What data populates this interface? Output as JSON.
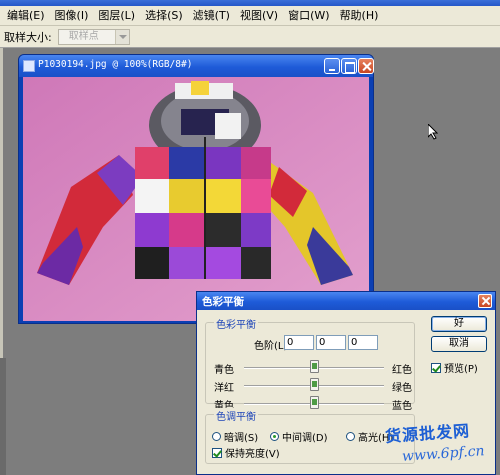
{
  "menu": [
    "编辑(E)",
    "图像(I)",
    "图层(L)",
    "选择(S)",
    "滤镜(T)",
    "视图(V)",
    "窗口(W)",
    "帮助(H)"
  ],
  "options": {
    "label": "取样大小:",
    "select_value": "取样点"
  },
  "document": {
    "title": "P1030194.jpg @ 100%(RGB/8#)"
  },
  "dialog": {
    "title": "色彩平衡",
    "group1": "色彩平衡",
    "levels_label": "色阶(L):",
    "levels": [
      "0",
      "0",
      "0"
    ],
    "rows": [
      {
        "left": "青色",
        "right": "红色",
        "value": 0
      },
      {
        "left": "洋红",
        "right": "绿色",
        "value": 0
      },
      {
        "left": "黄色",
        "right": "蓝色",
        "value": 0
      }
    ],
    "group2": "色调平衡",
    "radios": [
      "暗调(S)",
      "中间调(D)",
      "高光(H)"
    ],
    "selected_radio": "中间调(D)",
    "preserve": "保持亮度(V)",
    "ok": "好",
    "cancel": "取消",
    "preview": "预览(P)"
  },
  "watermark": {
    "line1": "货源批发网",
    "line2": "www.6pf.cn"
  }
}
